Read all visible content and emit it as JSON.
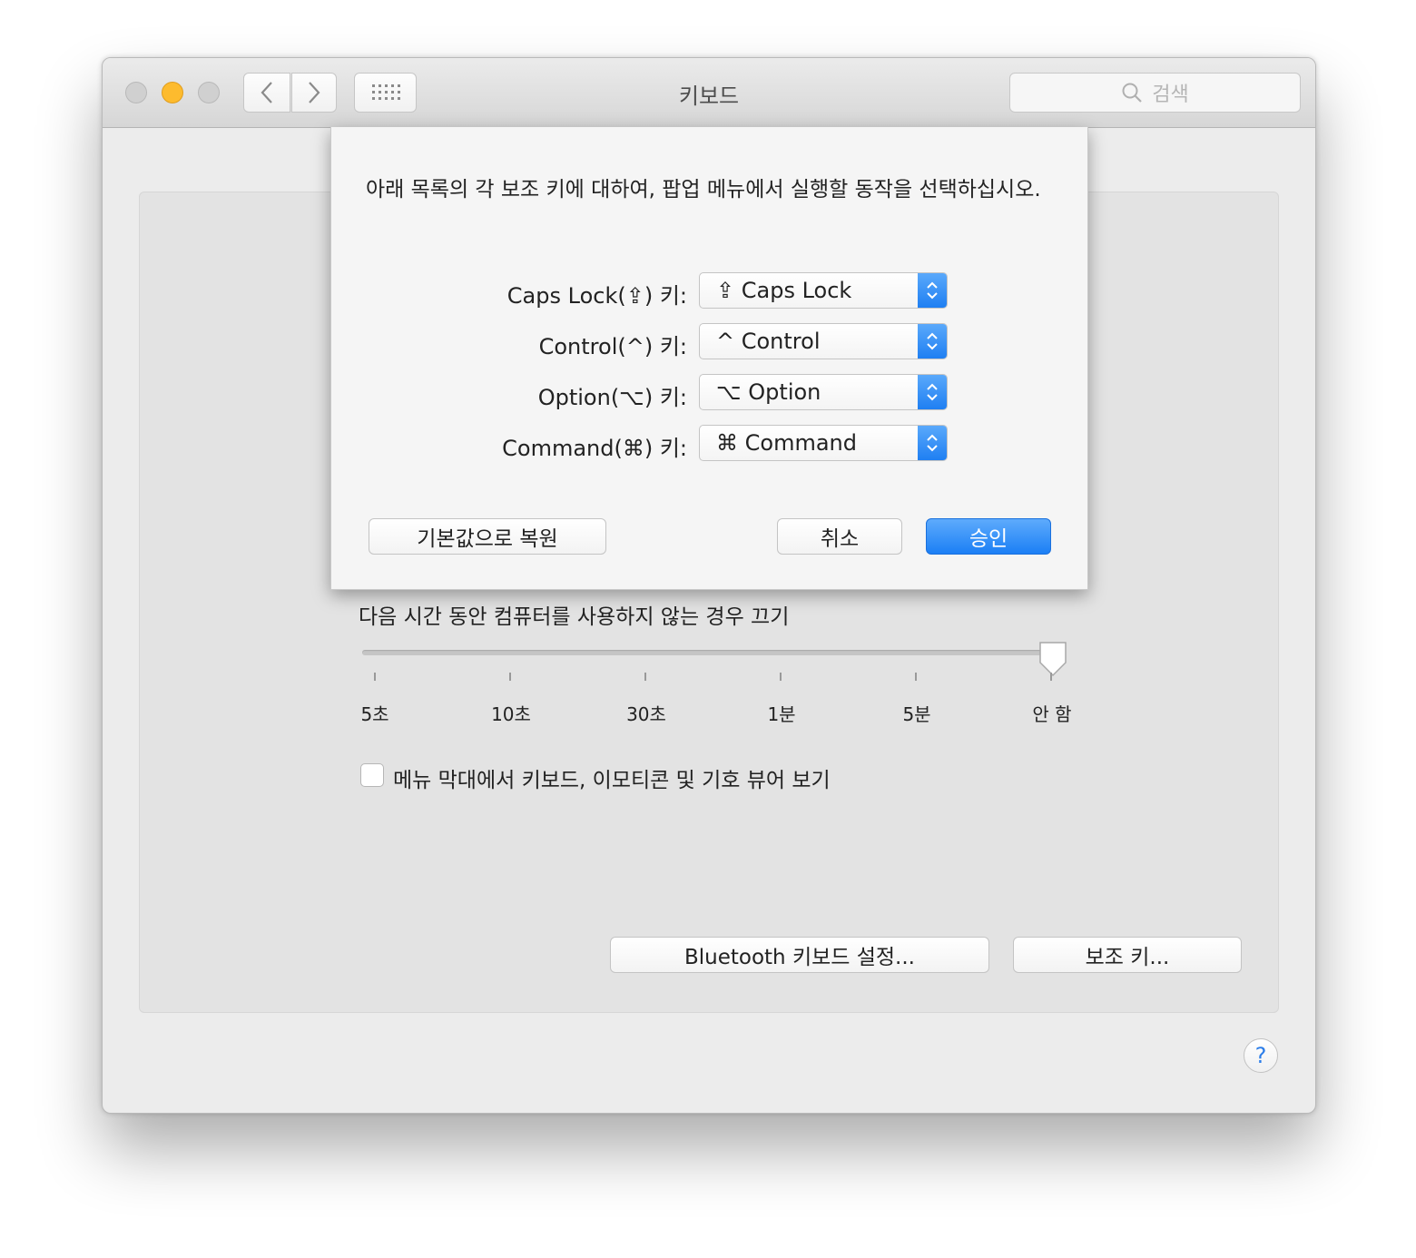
{
  "window": {
    "title": "키보드",
    "search": {
      "placeholder": "검색"
    },
    "traffic_lights": {
      "close": "#d0d0d0",
      "minimize": "#fdbb2e",
      "zoom": "#d0d0d0"
    }
  },
  "sheet": {
    "message": "아래 목록의 각 보조 키에 대하여, 팝업 메뉴에서 실행할 동작을 선택하십시오.",
    "modifiers": [
      {
        "label": "Caps Lock(⇪) 키:",
        "value": "⇪ Caps Lock"
      },
      {
        "label": "Control(^) 키:",
        "value": "^ Control"
      },
      {
        "label": "Option(⌥) 키:",
        "value": "⌥ Option"
      },
      {
        "label": "Command(⌘) 키:",
        "value": "⌘ Command"
      }
    ],
    "restore_button": "기본값으로 복원",
    "cancel_button": "취소",
    "ok_button": "승인"
  },
  "panel": {
    "backlight_off_label": "다음 시간 동안 컴퓨터를 사용하지 않는 경우 끄기",
    "slider": {
      "ticks": [
        "5초",
        "10초",
        "30초",
        "1분",
        "5분",
        "안 함"
      ],
      "selected": "안 함"
    },
    "show_viewer_checkbox": {
      "label": "메뉴 막대에서 키보드, 이모티콘 및 기호 뷰어 보기",
      "checked": false
    },
    "bluetooth_button": "Bluetooth 키보드 설정...",
    "modifier_keys_button": "보조 키..."
  },
  "help_button": "?",
  "colors": {
    "accent": "#1b7ff5"
  }
}
